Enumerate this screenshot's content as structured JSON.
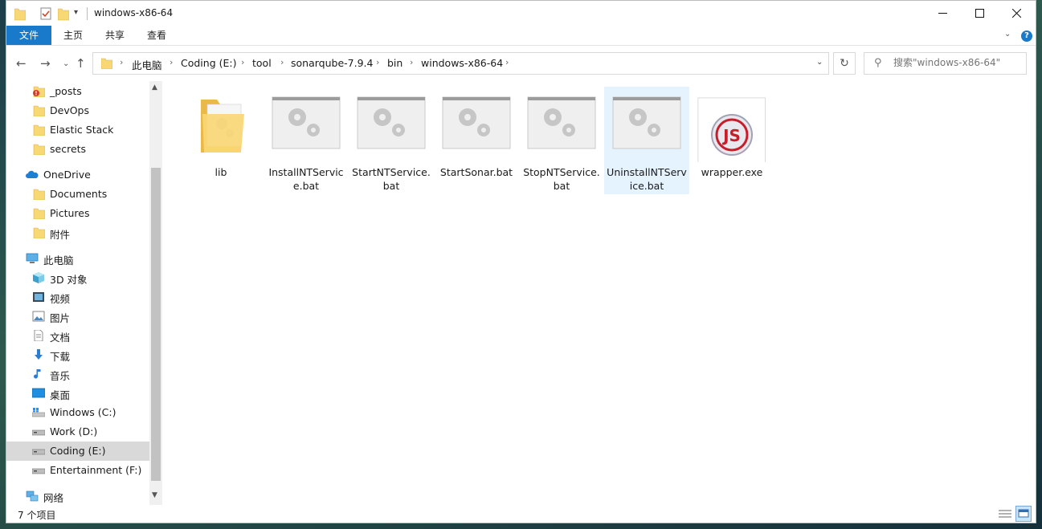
{
  "window": {
    "title": "windows-x86-64"
  },
  "ribbon": {
    "tabs": [
      "文件",
      "主页",
      "共享",
      "查看"
    ]
  },
  "address": {
    "crumbs": [
      "此电脑",
      "Coding (E:)",
      "tool",
      "sonarqube-7.9.4",
      "bin",
      "windows-x86-64"
    ]
  },
  "search": {
    "placeholder": "搜索\"windows-x86-64\""
  },
  "sidebar": {
    "items": [
      {
        "label": "_posts",
        "icon": "folder-warning-icon"
      },
      {
        "label": "DevOps",
        "icon": "folder-icon"
      },
      {
        "label": "Elastic Stack",
        "icon": "folder-icon"
      },
      {
        "label": "secrets",
        "icon": "folder-icon"
      },
      {
        "label": "OneDrive",
        "icon": "onedrive-cloud-icon"
      },
      {
        "label": "Documents",
        "icon": "folder-icon"
      },
      {
        "label": "Pictures",
        "icon": "folder-icon"
      },
      {
        "label": "附件",
        "icon": "folder-icon"
      },
      {
        "label": "此电脑",
        "icon": "pc-icon"
      },
      {
        "label": "3D 对象",
        "icon": "cube-3d-icon"
      },
      {
        "label": "视频",
        "icon": "video-icon"
      },
      {
        "label": "图片",
        "icon": "image-icon"
      },
      {
        "label": "文档",
        "icon": "document-icon"
      },
      {
        "label": "下载",
        "icon": "download-arrow-icon"
      },
      {
        "label": "音乐",
        "icon": "music-note-icon"
      },
      {
        "label": "桌面",
        "icon": "desktop-icon"
      },
      {
        "label": "Windows (C:)",
        "icon": "drive-windows-icon"
      },
      {
        "label": "Work (D:)",
        "icon": "drive-icon"
      },
      {
        "label": "Coding (E:)",
        "icon": "drive-icon"
      },
      {
        "label": "Entertainment (F:)",
        "icon": "drive-icon"
      },
      {
        "label": "网络",
        "icon": "network-icon"
      }
    ]
  },
  "files": [
    {
      "label": "lib",
      "icon": "folder-icon"
    },
    {
      "label": "InstallNTService.bat",
      "icon": "batch-file-gears-icon"
    },
    {
      "label": "StartNTService.bat",
      "icon": "batch-file-gears-icon"
    },
    {
      "label": "StartSonar.bat",
      "icon": "batch-file-gears-icon"
    },
    {
      "label": "StopNTService.bat",
      "icon": "batch-file-gears-icon"
    },
    {
      "label": "UninstallNTService.bat",
      "icon": "batch-file-gears-icon"
    },
    {
      "label": "wrapper.exe",
      "icon": "js-wrapper-exe-icon"
    }
  ],
  "status": {
    "count": "7 个项目"
  },
  "colors": {
    "accent": "#1979ca",
    "folder": "#f8d775",
    "selection": "#e5f3ff"
  }
}
